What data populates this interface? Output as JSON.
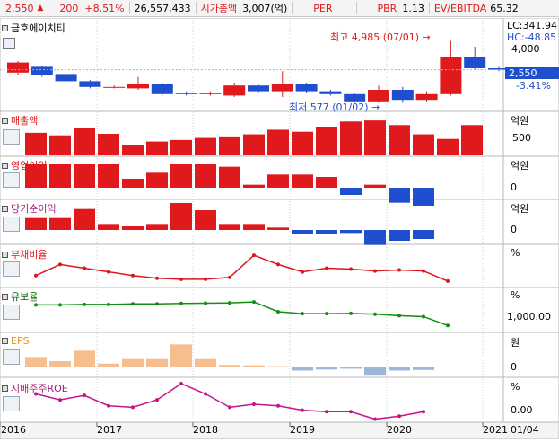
{
  "header": {
    "price": "2,550",
    "up_arrow": "▲",
    "change": "200",
    "change_pct": "+8.51%",
    "volume": "26,557,433",
    "mcap_label": "시가총액",
    "mcap_value": "3,007(억)",
    "per_label": "PER",
    "pbr_label": "PBR",
    "pbr_value": "1.13",
    "ev_label": "EV/EBITDA",
    "ev_value": "65.32"
  },
  "main_chart": {
    "title": "금호에이치티",
    "lc": "LC:341.94",
    "hc": "HC:-48.85",
    "y_4000": "4,000",
    "current_price": "2,550",
    "current_change": "-3.41%",
    "high_annotation": "최고 4,985 (07/01)",
    "low_annotation": "최저 577 (01/02)"
  },
  "panels": {
    "revenue": {
      "title": "매출액",
      "unit": "억원",
      "tick": "500"
    },
    "op_income": {
      "title": "영업이익",
      "unit": "억원",
      "tick": "0"
    },
    "net_income": {
      "title": "당기순이익",
      "unit": "억원",
      "tick": "0"
    },
    "debt_ratio": {
      "title": "부채비율",
      "unit": "%"
    },
    "reserve_ratio": {
      "title": "유보율",
      "unit": "%",
      "tick": "1,000.00"
    },
    "eps": {
      "title": "EPS",
      "unit": "원",
      "tick": "0"
    },
    "roe": {
      "title": "지배주주ROE",
      "unit": "%",
      "tick": "0.00"
    }
  },
  "x_axis": {
    "labels": [
      "2016",
      "2017",
      "2018",
      "2019",
      "2020",
      "2021"
    ],
    "right_label": "01/04"
  },
  "colors": {
    "up": "#e0191c",
    "down": "#1f4fcf",
    "eps": "#f6bd8e",
    "eps_neg": "#9cb8d8",
    "debt_line": "#d9161c",
    "reserve_line": "#109010",
    "roe_line": "#c4148c"
  },
  "chart_data": {
    "type": "bar",
    "quarters": 20,
    "candles": [
      {
        "o": 2.2,
        "c": 2.9,
        "h": 3.0,
        "l": 2.0
      },
      {
        "o": 2.6,
        "c": 2.0,
        "h": 2.7,
        "l": 1.9
      },
      {
        "o": 2.1,
        "c": 1.6,
        "h": 2.2,
        "l": 1.5
      },
      {
        "o": 1.6,
        "c": 1.2,
        "h": 1.7,
        "l": 1.1
      },
      {
        "o": 1.2,
        "c": 1.2,
        "h": 1.3,
        "l": 1.1
      },
      {
        "o": 1.1,
        "c": 1.4,
        "h": 1.9,
        "l": 1.0
      },
      {
        "o": 1.4,
        "c": 0.7,
        "h": 1.5,
        "l": 0.6
      },
      {
        "o": 0.8,
        "c": 0.7,
        "h": 0.9,
        "l": 0.6
      },
      {
        "o": 0.7,
        "c": 0.8,
        "h": 0.9,
        "l": 0.6
      },
      {
        "o": 0.6,
        "c": 1.3,
        "h": 1.5,
        "l": 0.5
      },
      {
        "o": 1.3,
        "c": 0.9,
        "h": 1.4,
        "l": 0.8
      },
      {
        "o": 0.9,
        "c": 1.4,
        "h": 2.3,
        "l": 0.5
      },
      {
        "o": 1.4,
        "c": 0.9,
        "h": 1.5,
        "l": 0.8
      },
      {
        "o": 0.9,
        "c": 0.7,
        "h": 1.0,
        "l": 0.6
      },
      {
        "o": 0.7,
        "c": 0.2,
        "h": 0.8,
        "l": 0.1
      },
      {
        "o": 0.2,
        "c": 1.0,
        "h": 1.3,
        "l": 0.1
      },
      {
        "o": 1.0,
        "c": 0.3,
        "h": 1.2,
        "l": 0.1
      },
      {
        "o": 0.3,
        "c": 0.7,
        "h": 0.9,
        "l": 0.2
      },
      {
        "o": 0.7,
        "c": 3.3,
        "h": 4.4,
        "l": 0.6
      },
      {
        "o": 3.3,
        "c": 2.5,
        "h": 4.0,
        "l": 2.4
      },
      {
        "o": 2.5,
        "c": 2.4,
        "h": 2.6,
        "l": 2.3
      }
    ],
    "revenue": [
      440,
      390,
      540,
      420,
      210,
      270,
      300,
      340,
      370,
      410,
      500,
      460,
      560,
      660,
      680,
      590,
      410,
      320,
      590
    ],
    "op_income": [
      40,
      40,
      40,
      40,
      15,
      25,
      40,
      40,
      35,
      5,
      22,
      22,
      18,
      -12,
      5,
      -25,
      -30
    ],
    "net_income": [
      20,
      20,
      35,
      10,
      6,
      10,
      45,
      33,
      10,
      10,
      4,
      -6,
      -6,
      -5,
      -25,
      -18,
      -15
    ],
    "debt_ratio": [
      60,
      72,
      68,
      64,
      60,
      57,
      56,
      56,
      58,
      82,
      72,
      64,
      68,
      67,
      65,
      66,
      65,
      54
    ],
    "reserve_ratio": [
      1120,
      1120,
      1130,
      1130,
      1140,
      1140,
      1150,
      1155,
      1160,
      1180,
      980,
      940,
      940,
      945,
      930,
      900,
      880,
      700
    ],
    "eps": [
      50,
      30,
      80,
      18,
      40,
      40,
      110,
      40,
      12,
      10,
      6,
      -15,
      -10,
      -6,
      -35,
      -15,
      -12
    ],
    "roe": [
      5,
      3,
      4.5,
      1,
      0.5,
      3,
      8.5,
      5,
      0.5,
      1.5,
      1,
      -0.5,
      -1,
      -1,
      -3.5,
      -2.5,
      -1
    ]
  }
}
